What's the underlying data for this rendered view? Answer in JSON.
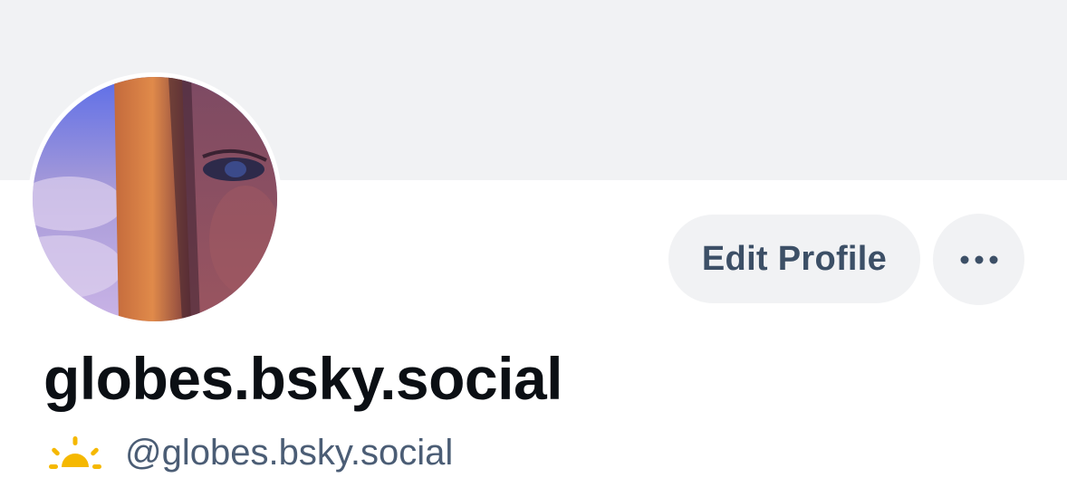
{
  "profile": {
    "display_name": "globes.bsky.social",
    "handle": "@globes.bsky.social",
    "status_icon": "sunrise-icon"
  },
  "actions": {
    "edit_label": "Edit Profile",
    "more_icon": "ellipsis-icon"
  },
  "colors": {
    "banner": "#f1f2f4",
    "button_bg": "#f1f2f4",
    "button_text": "#3c4f66",
    "name_text": "#0b0f14",
    "handle_text": "#4b5d75",
    "sun": "#f5b800"
  }
}
